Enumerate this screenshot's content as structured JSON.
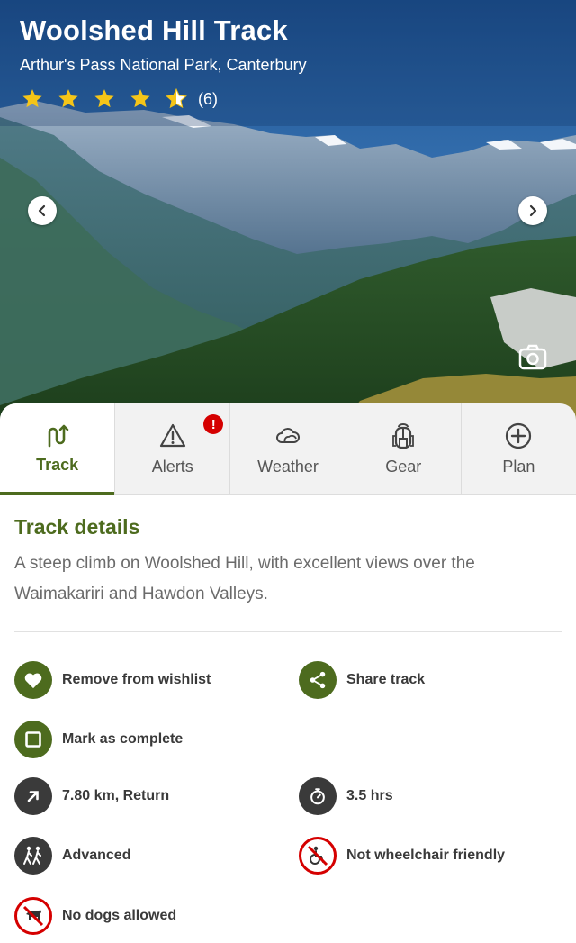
{
  "track": {
    "title": "Woolshed Hill Track",
    "location": "Arthur's Pass National Park, Canterbury",
    "rating": {
      "stars": 4.5,
      "count_label": "(6)"
    }
  },
  "tabs": [
    {
      "label": "Track",
      "icon": "track-route-icon",
      "active": true
    },
    {
      "label": "Alerts",
      "icon": "warning-triangle-icon",
      "badge": "!"
    },
    {
      "label": "Weather",
      "icon": "cloud-icon"
    },
    {
      "label": "Gear",
      "icon": "backpack-icon"
    },
    {
      "label": "Plan",
      "icon": "plus-circle-icon"
    }
  ],
  "details": {
    "heading": "Track details",
    "description": "A steep climb on Woolshed Hill, with excellent views over the Waimakariri and Hawdon Valleys."
  },
  "actions": {
    "wishlist": "Remove from wishlist",
    "share": "Share track",
    "complete": "Mark as complete"
  },
  "facts": {
    "distance": "7.80 km, Return",
    "duration": "3.5 hrs",
    "difficulty": "Advanced",
    "wheelchair": "Not wheelchair friendly",
    "dogs": "No dogs allowed"
  },
  "colors": {
    "brand_green": "#4d6b1e",
    "alert_red": "#d50000",
    "dark_icon": "#3a3a3a"
  }
}
